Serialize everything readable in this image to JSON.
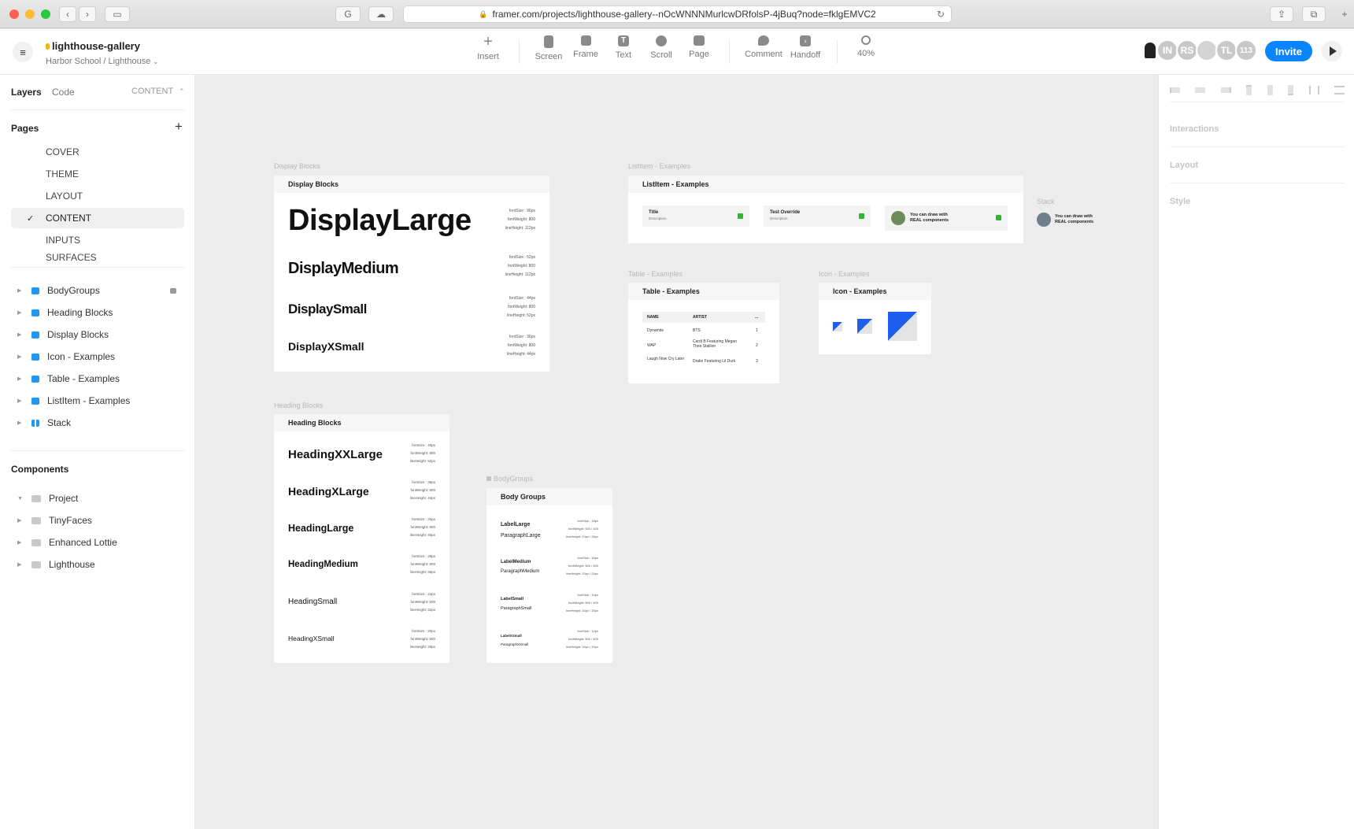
{
  "browser": {
    "url": "framer.com/projects/lighthouse-gallery--nOcWNNNMurlcwDRfolsP-4jBuq?node=fklgEMVC2"
  },
  "project": {
    "name": "lighthouse-gallery",
    "breadcrumb": "Harbor School / Lighthouse"
  },
  "toolbar": {
    "tools": [
      {
        "label": "Insert",
        "icon": "plus-icon"
      },
      {
        "label": "Screen",
        "icon": "screen-icon"
      },
      {
        "label": "Frame",
        "icon": "frame-icon"
      },
      {
        "label": "Text",
        "icon": "text-icon"
      },
      {
        "label": "Scroll",
        "icon": "scroll-icon"
      },
      {
        "label": "Page",
        "icon": "page-icon"
      },
      {
        "label": "Comment",
        "icon": "comment-icon"
      },
      {
        "label": "Handoff",
        "icon": "handoff-icon"
      }
    ],
    "zoom": "40%",
    "avatars": [
      "IN",
      "RS",
      "",
      "TL",
      "113"
    ],
    "invite_label": "Invite"
  },
  "left_panel": {
    "tabs": {
      "layers": "Layers",
      "code": "Code",
      "current_page": "CONTENT"
    },
    "pages_title": "Pages",
    "pages": [
      "COVER",
      "THEME",
      "LAYOUT",
      "CONTENT",
      "INPUTS",
      "SURFACES"
    ],
    "selected_page": "CONTENT",
    "layers": [
      {
        "label": "BodyGroups",
        "icon": "stack-icon",
        "locked": true
      },
      {
        "label": "Heading Blocks",
        "icon": "stack-icon"
      },
      {
        "label": "Display Blocks",
        "icon": "stack-icon"
      },
      {
        "label": "Icon - Examples",
        "icon": "stack-icon"
      },
      {
        "label": "Table - Examples",
        "icon": "stack-icon"
      },
      {
        "label": "ListItem - Examples",
        "icon": "stack-icon"
      },
      {
        "label": "Stack",
        "icon": "horizontal-stack-icon"
      }
    ],
    "components_title": "Components",
    "components": [
      "Project",
      "TinyFaces",
      "Enhanced Lottie",
      "Lighthouse"
    ]
  },
  "right_panel": {
    "sections": [
      "Interactions",
      "Layout",
      "Style"
    ]
  },
  "canvas": {
    "display_blocks": {
      "label": "Display Blocks",
      "title": "Display Blocks",
      "items": [
        {
          "text": "DisplayLarge",
          "spec": [
            "fontSize : 96px",
            "fontWeight: 800",
            "lineHeight: 112px"
          ]
        },
        {
          "text": "DisplayMedium",
          "spec": [
            "fontSize : 52px",
            "fontWeight: 800",
            "lineHeight: 112px"
          ]
        },
        {
          "text": "DisplaySmall",
          "spec": [
            "fontSize : 44px",
            "fontWeight: 800",
            "lineHeight: 52px"
          ]
        },
        {
          "text": "DisplayXSmall",
          "spec": [
            "fontSize : 36px",
            "fontWeight: 800",
            "lineHeight: 44px"
          ]
        }
      ]
    },
    "heading_blocks": {
      "label": "Heading Blocks",
      "title": "Heading Blocks",
      "items": [
        {
          "text": "HeadingXXLarge",
          "spec": [
            "fontSize : 40px",
            "fontWeight: 800",
            "lineHeight: 52px"
          ]
        },
        {
          "text": "HeadingXLarge",
          "spec": [
            "fontSize : 36px",
            "fontWeight: 800",
            "lineHeight: 44px"
          ]
        },
        {
          "text": "HeadingLarge",
          "spec": [
            "fontSize : 32px",
            "fontWeight: 800",
            "lineHeight: 40px"
          ]
        },
        {
          "text": "HeadingMedium",
          "spec": [
            "fontSize : 28px",
            "fontWeight: 800",
            "lineHeight: 36px"
          ]
        },
        {
          "text": "HeadingSmall",
          "spec": [
            "fontSize : 24px",
            "fontWeight: 500",
            "lineHeight: 32px"
          ]
        },
        {
          "text": "HeadingXSmall",
          "spec": [
            "fontSize : 20px",
            "fontWeight: 500",
            "lineHeight: 28px"
          ]
        }
      ]
    },
    "body_groups": {
      "label": "BodyGroups",
      "title": "Body Groups",
      "items": [
        {
          "label": "LabelLarge",
          "paragraph": "ParagraphLarge",
          "spec": [
            "fontSize : 18px",
            "fontWeight: 500 / 400",
            "lineHeight: 24px / 28px"
          ]
        },
        {
          "label": "LabelMedium",
          "paragraph": "ParagraphMedium",
          "spec": [
            "fontSize : 16px",
            "fontWeight: 500 / 400",
            "lineHeight: 20px / 24px"
          ]
        },
        {
          "label": "LabelSmall",
          "paragraph": "ParagraphSmall",
          "spec": [
            "fontSize : 14px",
            "fontWeight: 500 / 400",
            "lineHeight: 16px / 20px"
          ]
        },
        {
          "label": "LabelXSmall",
          "paragraph": "ParagraphXSmall",
          "spec": [
            "fontSize : 12px",
            "fontWeight: 500 / 400",
            "lineHeight: 16px / 20px"
          ]
        }
      ]
    },
    "listitem_examples": {
      "label": "ListItem - Examples",
      "title": "ListItem - Examples",
      "items": [
        {
          "title": "Title",
          "desc": "Description"
        },
        {
          "title": "Test Override",
          "desc": "Description"
        },
        {
          "title": "You can draw with",
          "desc": "REAL components"
        }
      ]
    },
    "stack": {
      "label": "Stack",
      "line1": "You can draw with",
      "line2": "REAL components"
    },
    "table_examples": {
      "label": "Table - Examples",
      "title": "Table - Examples",
      "headers": [
        "NAME",
        "ARTIST",
        "..."
      ],
      "rows": [
        [
          "Dynamite",
          "BTS",
          "1"
        ],
        [
          "WAP",
          "Cardi B Featuring Megan Thee Stallion",
          "2"
        ],
        [
          "Laugh Now Cry Later",
          "Drake Featuring Lil Durk",
          "3"
        ]
      ]
    },
    "icon_examples": {
      "label": "Icon - Examples",
      "title": "Icon - Examples"
    }
  },
  "colors": {
    "accent": "#0a84ff",
    "icon_blue": "#1f5ff0",
    "check_green": "#2eb82e",
    "layer_icon": "#2196f3"
  }
}
